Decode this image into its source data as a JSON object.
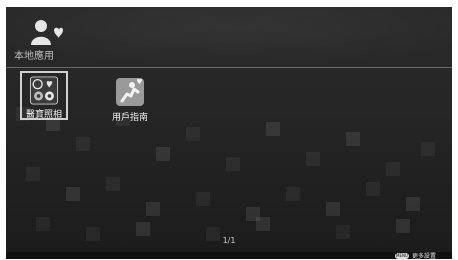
{
  "header": {
    "title": "本地應用",
    "icon": "user-heart-icon"
  },
  "apps": [
    {
      "label": "醫寶照相",
      "icon": "camera-collage-icon",
      "selected": true
    },
    {
      "label": "用戶指南",
      "icon": "guide-run-icon",
      "selected": false
    }
  ],
  "pager": {
    "text": "1/1"
  },
  "footer": {
    "button_label": "MENU",
    "hint": "更多設置"
  }
}
